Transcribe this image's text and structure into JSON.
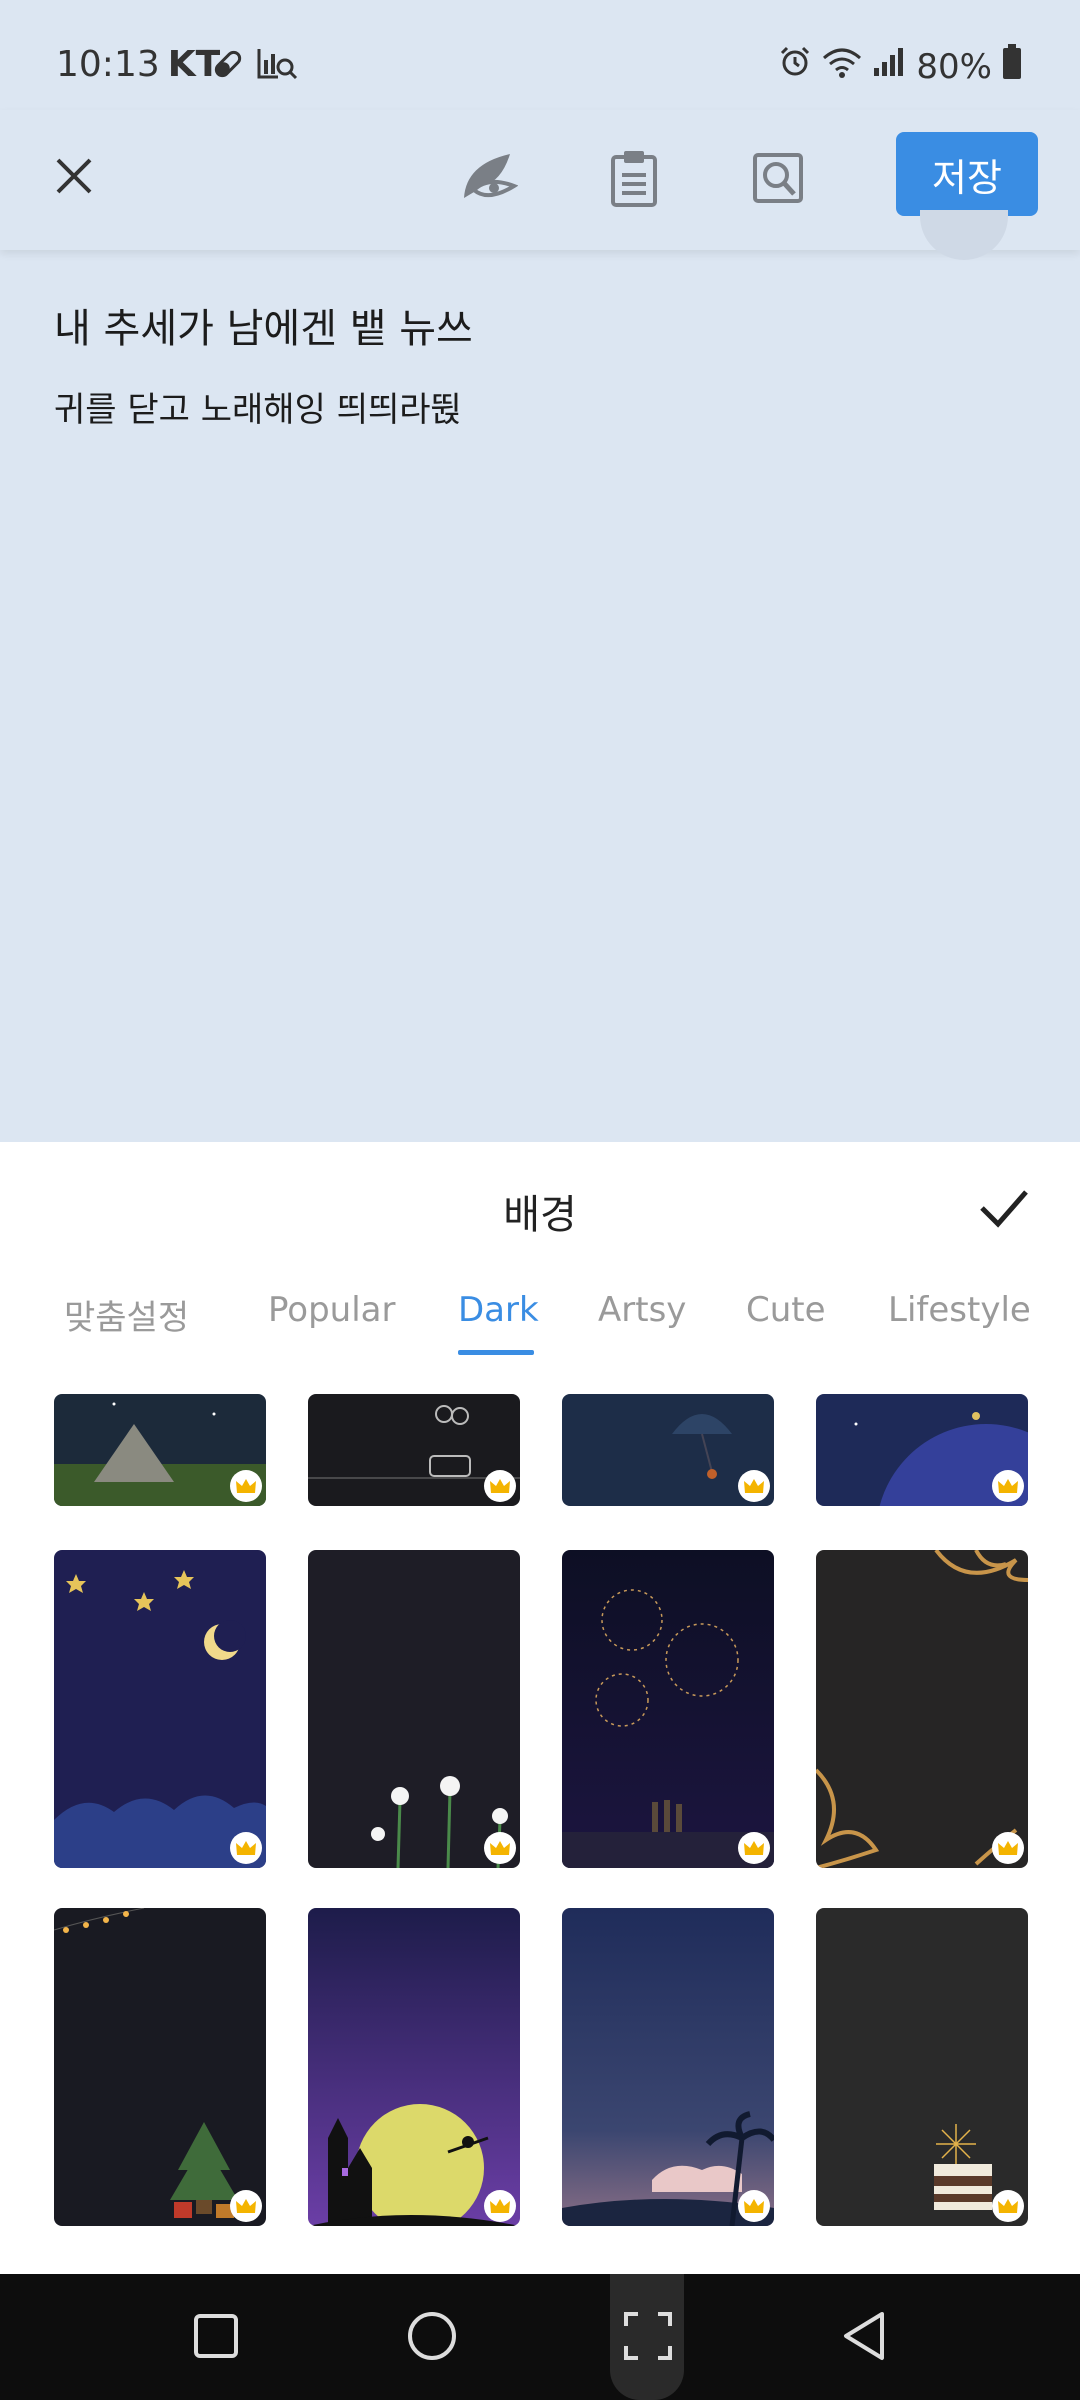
{
  "status_bar": {
    "time": "10:13",
    "carrier": "KT",
    "battery": "80%"
  },
  "toolbar": {
    "save_label": "저장",
    "accent_color": "#3a8de3"
  },
  "note": {
    "title": "내 추세가 남에겐 뱉 뉴쓰",
    "body": "귀를 닫고 노래해잉 띄띄라뛵"
  },
  "sheet": {
    "title": "배경",
    "tabs": [
      {
        "label": "맞춤설정",
        "active": false
      },
      {
        "label": "Popular",
        "active": false
      },
      {
        "label": "Dark",
        "active": true
      },
      {
        "label": "Artsy",
        "active": false
      },
      {
        "label": "Cute",
        "active": false
      },
      {
        "label": "Lifestyle",
        "active": false
      }
    ],
    "backgrounds": [
      {
        "theme": "tent-night",
        "premium": true
      },
      {
        "theme": "balloon-car",
        "premium": true
      },
      {
        "theme": "umbrella-rain",
        "premium": true
      },
      {
        "theme": "planet-stars",
        "premium": true
      },
      {
        "theme": "moon-clouds",
        "premium": true
      },
      {
        "theme": "white-flowers",
        "premium": true
      },
      {
        "theme": "fireworks",
        "premium": true
      },
      {
        "theme": "gold-ornament",
        "premium": true
      },
      {
        "theme": "christmas-tree",
        "premium": true
      },
      {
        "theme": "halloween-castle",
        "premium": true
      },
      {
        "theme": "palm-sunset",
        "premium": true
      },
      {
        "theme": "birthday-cake",
        "premium": true
      }
    ]
  },
  "icons": {
    "close": "close-icon",
    "reading_mode": "leaf-eye-icon",
    "clipboard": "clipboard-icon",
    "search": "search-icon",
    "confirm": "checkmark-icon",
    "premium": "crown-icon"
  }
}
